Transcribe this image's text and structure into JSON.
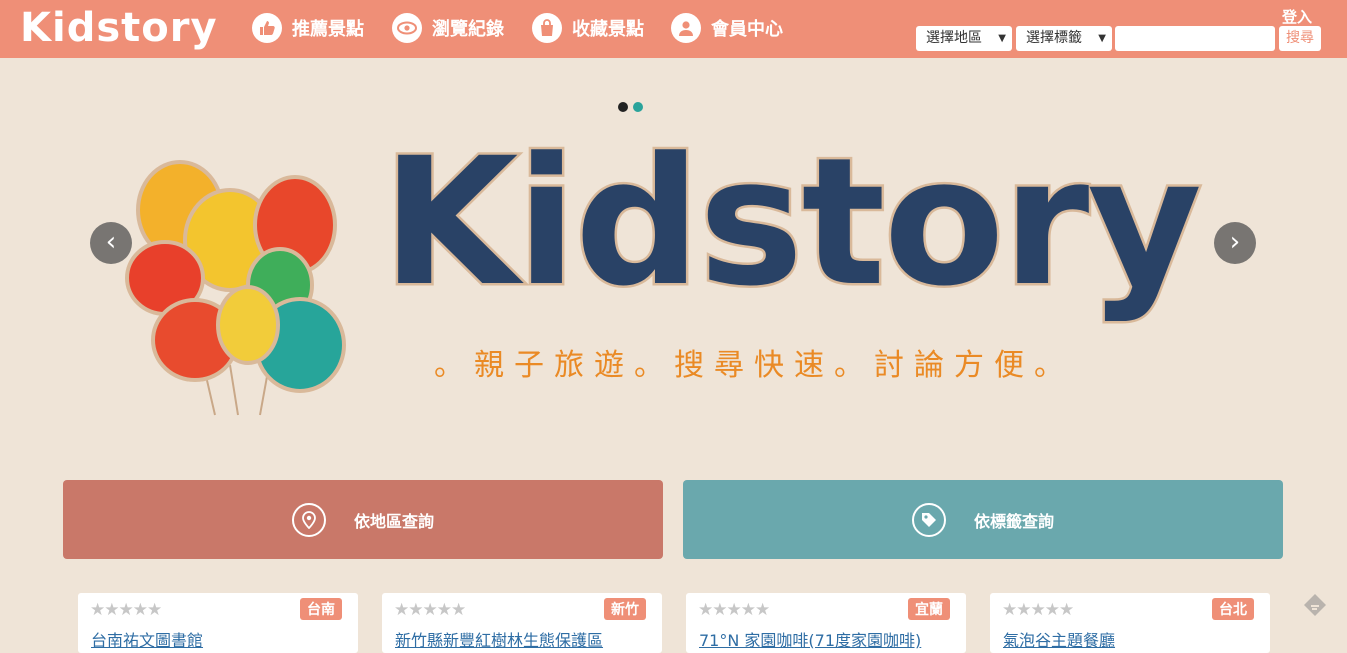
{
  "header": {
    "logo": "Kidstory",
    "nav": [
      {
        "label": "推薦景點",
        "icon": "thumbs-up-icon"
      },
      {
        "label": "瀏覽紀錄",
        "icon": "eye-icon"
      },
      {
        "label": "收藏景點",
        "icon": "bag-icon"
      },
      {
        "label": "會員中心",
        "icon": "user-icon"
      }
    ],
    "login": "登入",
    "region_select": "選擇地區",
    "tag_select": "選擇標籤",
    "search_value": "",
    "search_button": "搜尋"
  },
  "carousel": {
    "title": "Kidstory",
    "slogan": "。親子旅遊。搜尋快速。討論方便。",
    "prev": "‹",
    "next": "›"
  },
  "query": {
    "by_region": "依地區查詢",
    "by_tag": "依標籤查詢"
  },
  "cards": [
    {
      "region": "台南",
      "title": "台南祐文圖書館"
    },
    {
      "region": "新竹",
      "title": "新竹縣新豐紅樹林生態保護區"
    },
    {
      "region": "宜蘭",
      "title": "71°N 家園咖啡(71度家園咖啡)"
    },
    {
      "region": "台北",
      "title": "氣泡谷主題餐廳"
    }
  ],
  "colors": {
    "header_bg": "#ef8f77",
    "page_bg": "#efe4d7",
    "region_btn": "#c97869",
    "tag_btn": "#6aa8ad",
    "slogan": "#ea8a25"
  }
}
